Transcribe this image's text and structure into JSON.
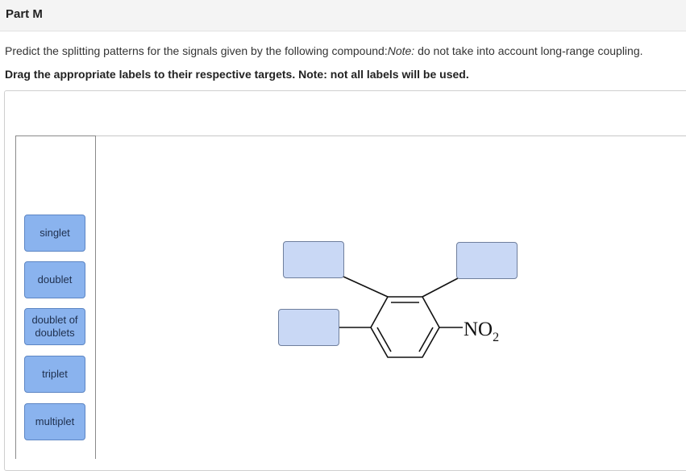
{
  "header": {
    "title": "Part M"
  },
  "question": {
    "prefix": "Predict the splitting patterns for the signals given by the following compound:",
    "note_label": "Note:",
    "note_text": " do not take into account long-range coupling."
  },
  "instruction": "Drag the appropriate labels to their respective targets. Note: not all labels will be used.",
  "labels": [
    {
      "text": "singlet"
    },
    {
      "text": "doublet"
    },
    {
      "text": "doublet of doublets"
    },
    {
      "text": "triplet"
    },
    {
      "text": "multiplet"
    }
  ],
  "molecule": {
    "substituent": "NO",
    "subscript": "2"
  },
  "colors": {
    "label_fill": "#8ab3ee",
    "target_fill": "#c9d8f5"
  }
}
